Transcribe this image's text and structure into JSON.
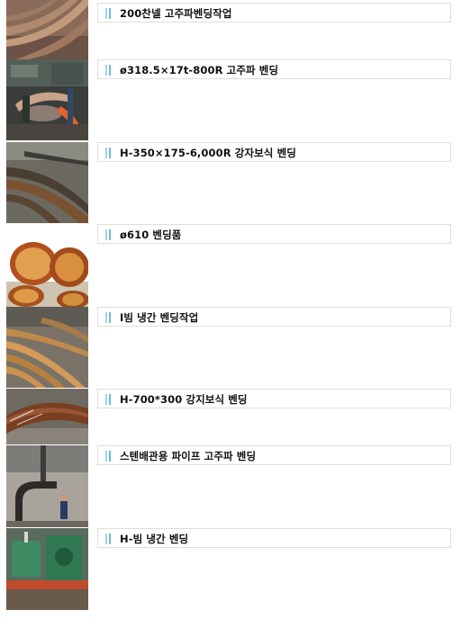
{
  "items": [
    {
      "title": "200찬넬 고주파벤딩작업",
      "image": "curved-channel-beams-photo"
    },
    {
      "title": "ø318.5×17t-800R 고주파 벤딩",
      "image": "high-frequency-bending-machine-photo"
    },
    {
      "title": "H-350×175-6,000R 강자보식 벤딩",
      "image": "curved-h-beam-stack-photo"
    },
    {
      "title": "ø610 벤딩품",
      "image": "bent-pipe-ends-photo"
    },
    {
      "title": "I빔 냉간 벤딩작업",
      "image": "cold-bent-i-beams-photo"
    },
    {
      "title": "H-700*300 강지보식 벤딩",
      "image": "large-curved-h-beam-photo"
    },
    {
      "title": "스텐배관용 파이프 고주파 벤딩",
      "image": "stainless-pipe-bend-hoist-photo"
    },
    {
      "title": "H-빔 냉간 벤딩",
      "image": "h-beam-cold-bending-machine-photo"
    }
  ]
}
